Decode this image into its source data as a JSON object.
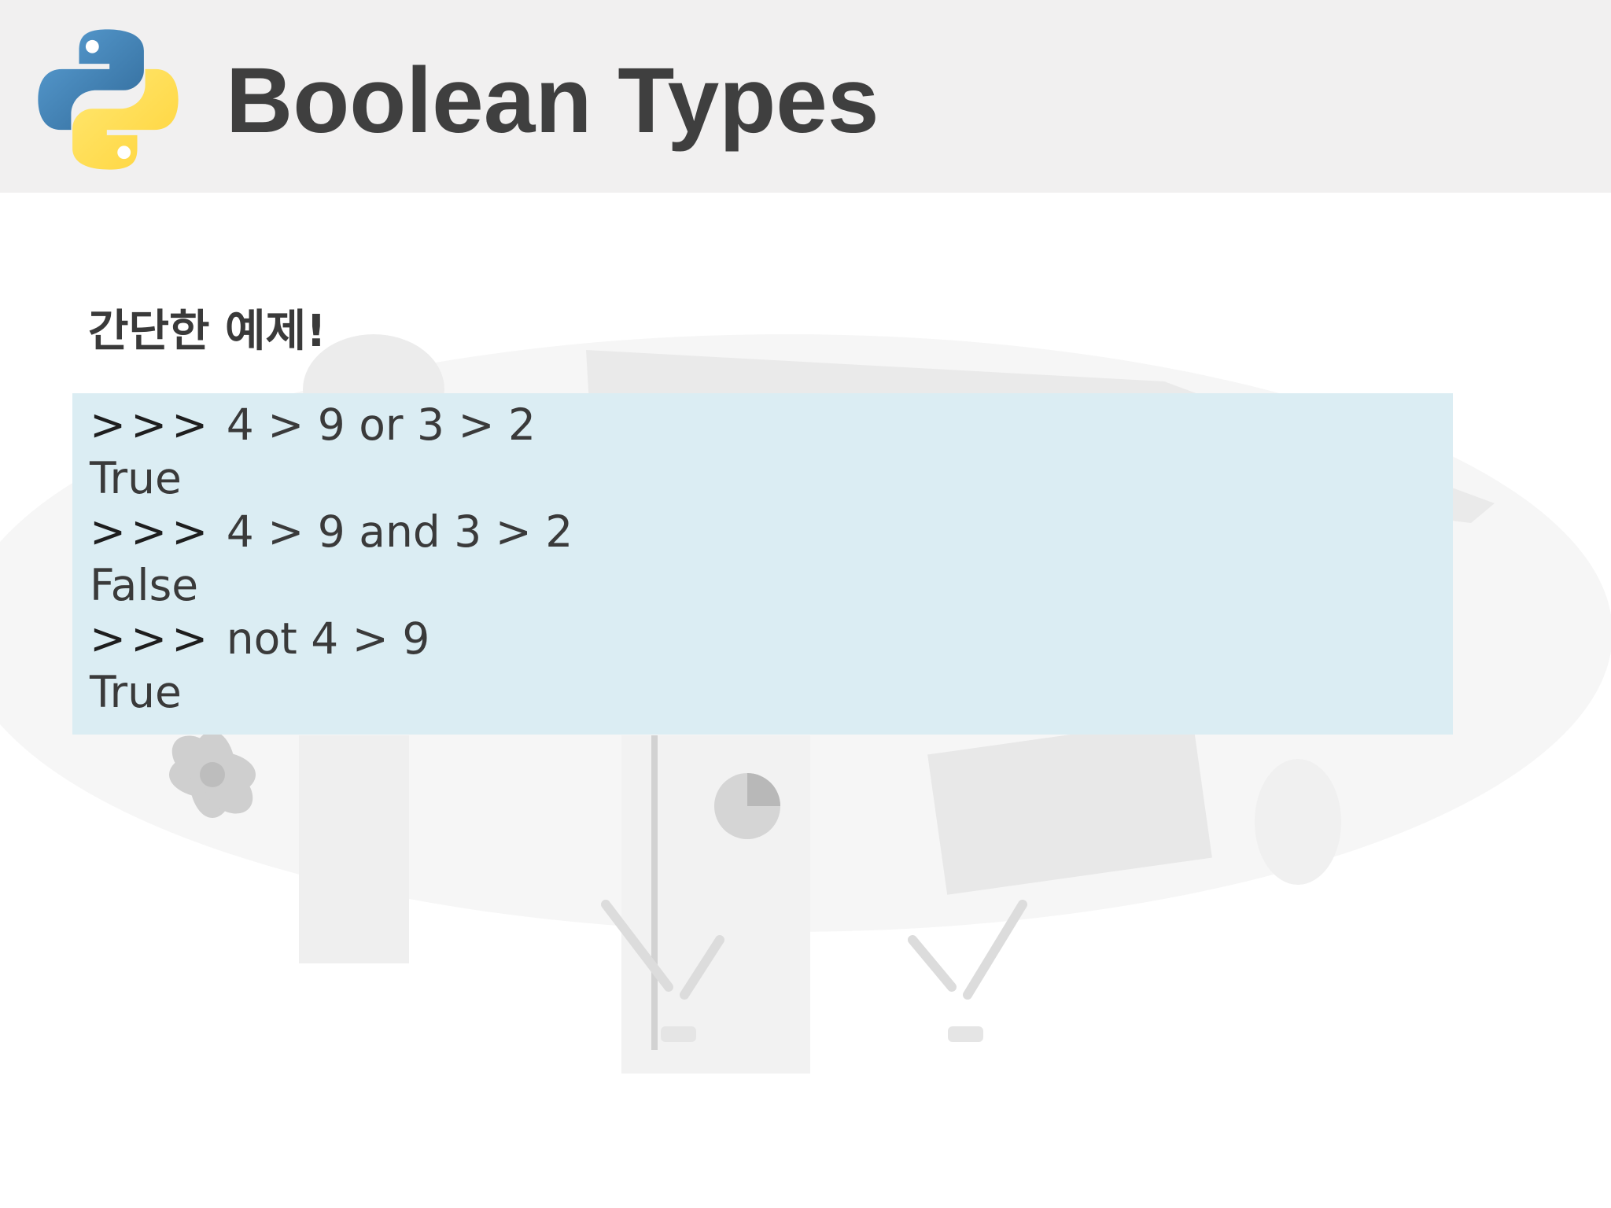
{
  "header": {
    "title": "Boolean Types",
    "logo_icon": "python-logo-icon",
    "logo_colors": {
      "blue": "#3a72a8",
      "yellow": "#fdd443"
    },
    "background": "#f1f0f0"
  },
  "content": {
    "subheading": "간단한 예제!",
    "code_box_color": "#dbedf3",
    "code_lines": [
      {
        "prompt": ">>>",
        "text": " 4 > 9 or 3 > 2"
      },
      {
        "prompt": "",
        "text": "True"
      },
      {
        "prompt": ">>>",
        "text": " 4 > 9 and 3 > 2"
      },
      {
        "prompt": "",
        "text": "False"
      },
      {
        "prompt": ">>>",
        "text": " not 4 > 9"
      },
      {
        "prompt": "",
        "text": "True"
      }
    ]
  }
}
